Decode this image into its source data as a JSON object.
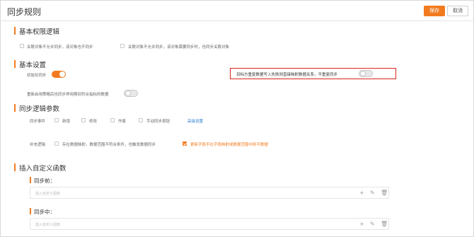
{
  "header": {
    "title": "同步规则",
    "save_label": "保存",
    "cancel_label": "取消"
  },
  "basic_permission": {
    "title": "基本权限逻辑",
    "opt1": "关联对象不允许同步，该对象也不同步",
    "opt2": "关联对象不允许同步，该对象需要同步时，也同步关联对象"
  },
  "basic_settings": {
    "title": "基本设置",
    "init_sync_label": "初始化同步",
    "init_sync_on": true,
    "overwrite_label": "目标方重复数据写入失败则直接映射数据关系，不重复同步",
    "overwrite_on": false,
    "resume_label": "重新启用策略后也同步停用期间符合指标的数据",
    "resume_on": false
  },
  "sync_params": {
    "title": "同步逻辑参数",
    "events_label": "同步事件",
    "events": [
      "新增",
      "修改",
      "作废",
      "手动同步按钮"
    ],
    "advanced_link": "高级设置",
    "supplement_label": "补充逻辑",
    "supp_opt1": "存在数据映射，数据范围不符合条件，也触发数据同步",
    "supp_opt2": "更新字段不在字段映射或数据范围中则不数据"
  },
  "custom_functions": {
    "title": "插入自定义函数",
    "before_label": "同步前：",
    "before_placeholder": "插入自定义函数",
    "during_label": "同步中：",
    "during_placeholder": "插入自定义函数"
  },
  "icons": [
    "plus-icon",
    "edit-icon",
    "delete-icon"
  ],
  "colors": {
    "accent": "#f27b20",
    "highlight": "#d9241c",
    "link": "#2b7cd3"
  }
}
